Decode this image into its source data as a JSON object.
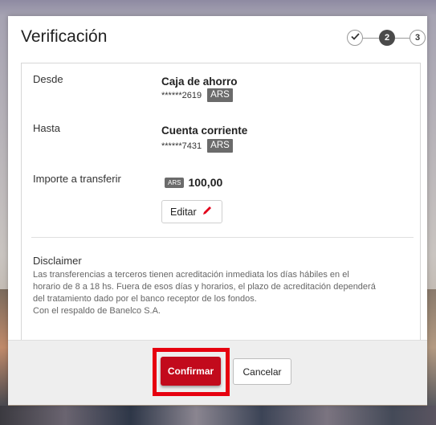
{
  "modal": {
    "title": "Verificación",
    "steps": [
      {
        "label": "",
        "state": "completed",
        "icon": "checkmark-icon"
      },
      {
        "label": "2",
        "state": "current"
      },
      {
        "label": "3",
        "state": "pending"
      }
    ]
  },
  "transfer": {
    "from_label": "Desde",
    "from_account": "Caja de ahorro",
    "from_number": "******2619",
    "from_currency": "ARS",
    "to_label": "Hasta",
    "to_account": "Cuenta corriente",
    "to_number": "******7431",
    "to_currency": "ARS",
    "amount_label": "Importe a transferir",
    "amount_currency": "ARS",
    "amount_value": "100,00",
    "edit_label": "Editar"
  },
  "disclaimer": {
    "title": "Disclaimer",
    "lines": [
      "Las transferencias a terceros tienen acreditación inmediata los días hábiles en el",
      "horario de 8 a 18 hs. Fuera de esos días y horarios, el plazo de acreditación dependerá",
      "del tratamiento dado por el banco receptor de los fondos.",
      "Con el respaldo de Banelco S.A."
    ]
  },
  "footer": {
    "confirm_label": "Confirmar",
    "cancel_label": "Cancelar"
  },
  "colors": {
    "accent": "#c20a1c",
    "highlight": "#e6000f",
    "badge": "#6b6b6b"
  }
}
